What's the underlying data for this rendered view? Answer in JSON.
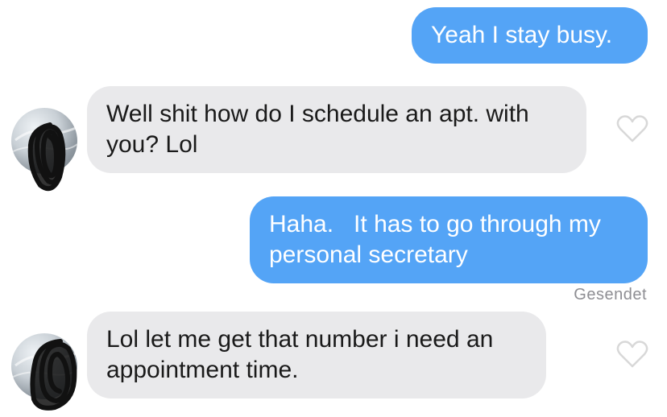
{
  "messages": [
    {
      "direction": "sent",
      "text": "Yeah I stay busy."
    },
    {
      "direction": "received",
      "text": "Well shit how do I schedule an apt. with\nyou? Lol"
    },
    {
      "direction": "sent",
      "text": "Haha.   It has to go through my\npersonal secretary"
    },
    {
      "direction": "received",
      "text": "Lol let me get that number i need an\nappointment time."
    }
  ],
  "status": {
    "sent_label": "Gesendet"
  },
  "icons": {
    "like": "heart-outline-icon",
    "avatar": "user-avatar"
  },
  "colors": {
    "sent_bubble": "#54a4f6",
    "received_bubble": "#e9e9eb",
    "status_text": "#8e8e93"
  }
}
